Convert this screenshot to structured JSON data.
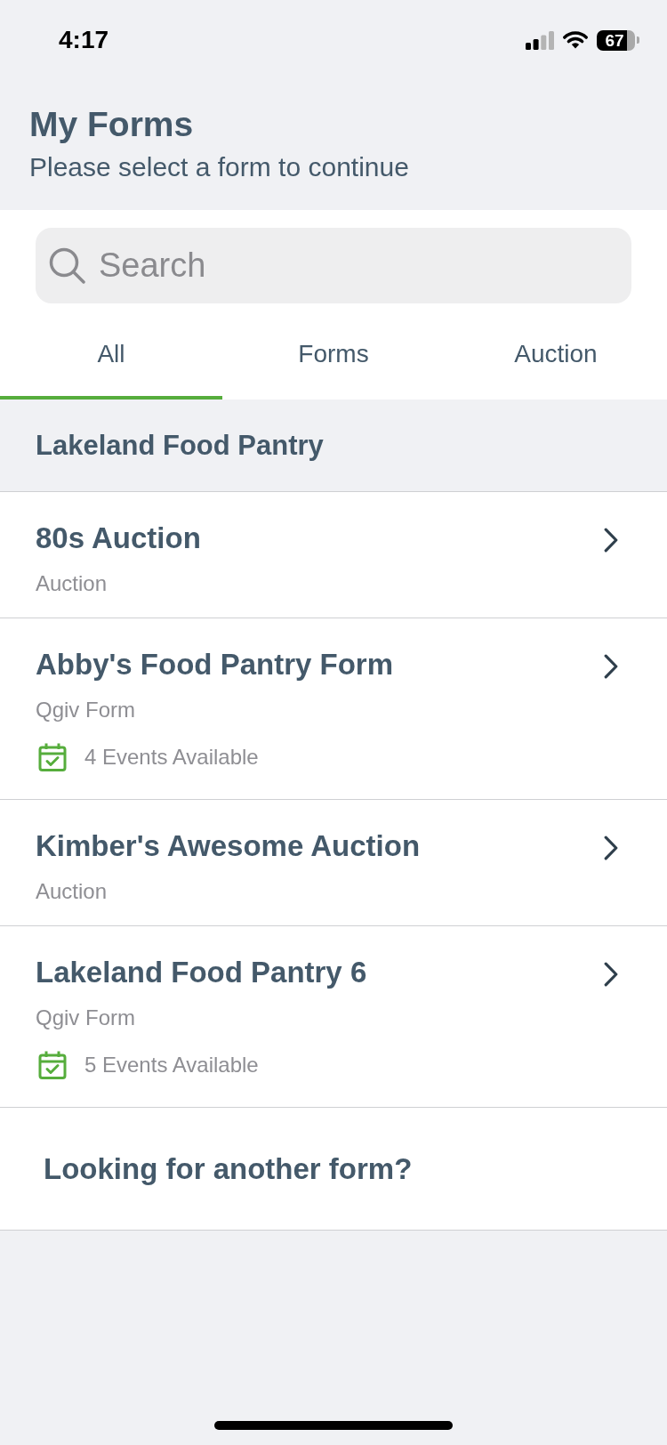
{
  "status_bar": {
    "time": "4:17",
    "battery": "67"
  },
  "header": {
    "title": "My Forms",
    "subtitle": "Please select a form to continue"
  },
  "search": {
    "placeholder": "Search"
  },
  "tabs": [
    {
      "label": "All",
      "selected": true
    },
    {
      "label": "Forms",
      "selected": false
    },
    {
      "label": "Auction",
      "selected": false
    }
  ],
  "sections": [
    {
      "title": "Lakeland Food Pantry",
      "items": [
        {
          "title": "80s Auction",
          "type": "Auction"
        },
        {
          "title": "Abby's Food Pantry Form",
          "type": "Qgiv Form",
          "events": "4 Events Available"
        },
        {
          "title": "Kimber's Awesome Auction",
          "type": "Auction"
        },
        {
          "title": "Lakeland Food Pantry 6",
          "type": "Qgiv Form",
          "events": "5 Events Available"
        }
      ]
    }
  ],
  "footer_link": "Looking for another form?"
}
